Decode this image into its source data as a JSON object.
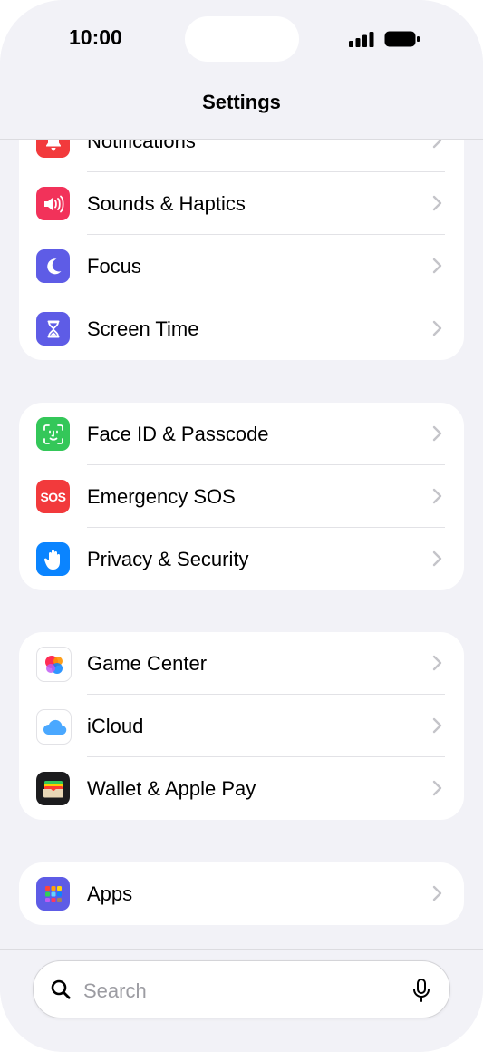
{
  "status": {
    "time": "10:00"
  },
  "nav": {
    "title": "Settings"
  },
  "groups": [
    {
      "items": [
        {
          "label": "Notifications",
          "icon": "bell-icon",
          "color": "#f23a3c"
        },
        {
          "label": "Sounds & Haptics",
          "icon": "speaker-icon",
          "color": "#f2325a"
        },
        {
          "label": "Focus",
          "icon": "moon-icon",
          "color": "#5e5ce6"
        },
        {
          "label": "Screen Time",
          "icon": "hourglass-icon",
          "color": "#5e5ce6"
        }
      ]
    },
    {
      "items": [
        {
          "label": "Face ID & Passcode",
          "icon": "face-id-icon",
          "color": "#34c759"
        },
        {
          "label": "Emergency SOS",
          "icon": "sos-icon",
          "icon_text": "SOS",
          "color": "#f23a3c"
        },
        {
          "label": "Privacy & Security",
          "icon": "hand-icon",
          "color": "#0a84ff"
        }
      ]
    },
    {
      "items": [
        {
          "label": "Game Center",
          "icon": "game-center-icon",
          "color": "#ffffff"
        },
        {
          "label": "iCloud",
          "icon": "cloud-icon",
          "color": "#ffffff"
        },
        {
          "label": "Wallet & Apple Pay",
          "icon": "wallet-icon",
          "color": "#1c1c1e"
        }
      ]
    },
    {
      "items": [
        {
          "label": "Apps",
          "icon": "apps-grid-icon",
          "color": "#5e5ce6"
        }
      ]
    }
  ],
  "search": {
    "placeholder": "Search"
  }
}
